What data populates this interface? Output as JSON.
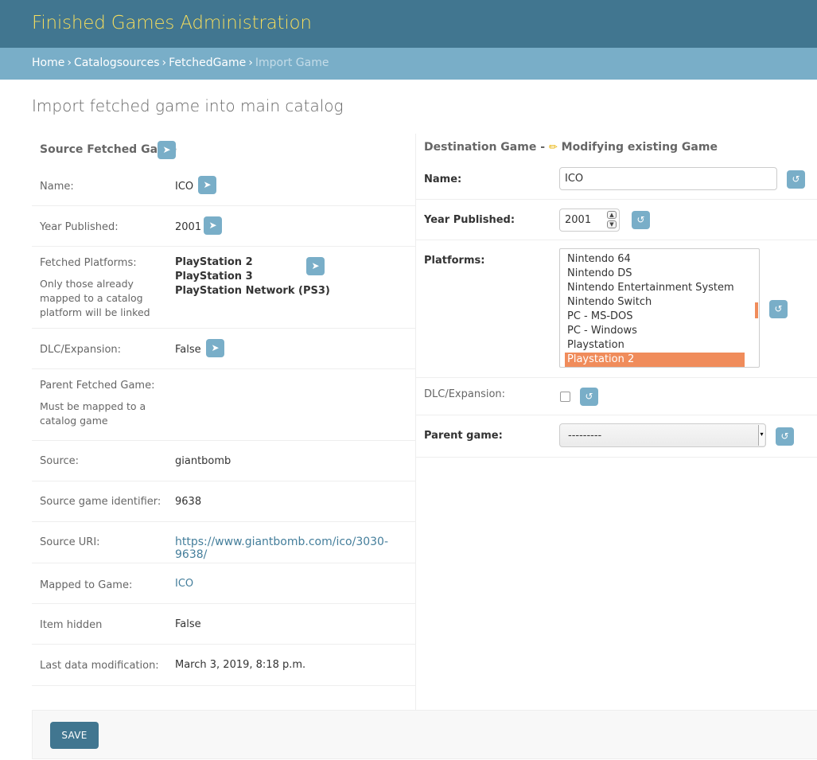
{
  "header": {
    "site_title": "Finished Games Administration"
  },
  "breadcrumbs": {
    "items": [
      "Home",
      "Catalogsources",
      "FetchedGame"
    ],
    "current": "Import Game",
    "separator": "›"
  },
  "page_title": "Import fetched game into main catalog",
  "source": {
    "heading": "Source Fetched Game",
    "go_icon": "➤",
    "fields": {
      "name": {
        "label": "Name:",
        "value": "ICO"
      },
      "year": {
        "label": "Year Published:",
        "value": "2001"
      },
      "platforms": {
        "label": "Fetched Platforms:",
        "help": "Only those already mapped to a catalog platform will be linked",
        "values": [
          "PlayStation 2",
          "PlayStation 3",
          "PlayStation Network (PS3)"
        ]
      },
      "dlc": {
        "label": "DLC/Expansion:",
        "value": "False"
      },
      "parent": {
        "label": "Parent Fetched Game:",
        "help": "Must be mapped to a catalog game",
        "value": ""
      },
      "source": {
        "label": "Source:",
        "value": "giantbomb"
      },
      "source_id": {
        "label": "Source game identifier:",
        "value": "9638"
      },
      "source_uri": {
        "label": "Source URI:",
        "value": "https://www.giantbomb.com/ico/3030-9638/"
      },
      "mapped": {
        "label": "Mapped to Game:",
        "value": "ICO"
      },
      "hidden": {
        "label": "Item hidden",
        "value": "False"
      },
      "modified": {
        "label": "Last data modification:",
        "value": "March 3, 2019, 8:18 p.m."
      }
    }
  },
  "destination": {
    "heading": "Destination Game -",
    "pencil_icon": "✏",
    "mode": "Modifying existing Game",
    "reset_icon": "↺",
    "fields": {
      "name": {
        "label": "Name:",
        "value": "ICO"
      },
      "year": {
        "label": "Year Published:",
        "value": "2001",
        "spin_up": "▲",
        "spin_down": "▼"
      },
      "platforms": {
        "label": "Platforms:",
        "options": [
          "Nintendo 64",
          "Nintendo DS",
          "Nintendo Entertainment System",
          "Nintendo Switch",
          "PC - MS-DOS",
          "PC - Windows",
          "Playstation",
          "Playstation 2"
        ],
        "selected": "Playstation 2"
      },
      "dlc": {
        "label": "DLC/Expansion:",
        "checked": false
      },
      "parent": {
        "label": "Parent game:",
        "value": "---------",
        "arrow": "▾"
      }
    }
  },
  "actions": {
    "save_label": "SAVE"
  },
  "colors": {
    "header": "#417690",
    "breadcrumbs": "#79aec8",
    "title": "#f5dd5d",
    "selected": "#f08c5b",
    "button": "#79aec8"
  }
}
